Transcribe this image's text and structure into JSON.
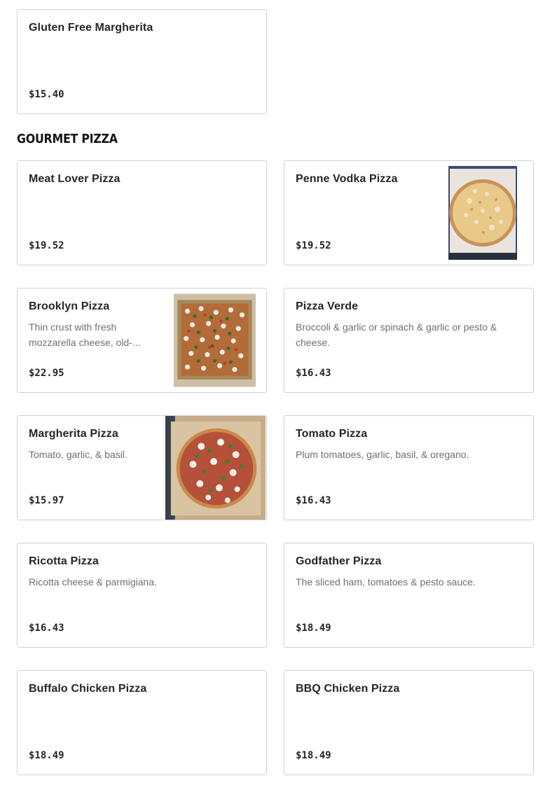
{
  "top_item": {
    "title": "Gluten Free Margherita",
    "price": "$15.40"
  },
  "section": {
    "title": "GOURMET PIZZA"
  },
  "items": [
    {
      "title": "Meat Lover Pizza",
      "desc": "",
      "price": "$19.52"
    },
    {
      "title": "Penne Vodka Pizza",
      "desc": "",
      "price": "$19.52",
      "image": "penne-vodka-pizza-photo"
    },
    {
      "title": "Brooklyn Pizza",
      "desc": "Thin crust with fresh mozzarella cheese, old-...",
      "price": "$22.95",
      "image": "brooklyn-pizza-photo"
    },
    {
      "title": "Pizza Verde",
      "desc": "Broccoli & garlic or spinach & garlic or pesto & cheese.",
      "price": "$16.43"
    },
    {
      "title": "Margherita Pizza",
      "desc": "Tomato, garlic, & basil.",
      "price": "$15.97",
      "image": "margherita-pizza-photo"
    },
    {
      "title": "Tomato Pizza",
      "desc": "Plum tomatoes, garlic, basil, & oregano.",
      "price": "$16.43"
    },
    {
      "title": "Ricotta Pizza",
      "desc": "Ricotta cheese & parmigiana.",
      "price": "$16.43"
    },
    {
      "title": "Godfather Pizza",
      "desc": "The sliced ham, tomatoes & pesto sauce.",
      "price": "$18.49"
    },
    {
      "title": "Buffalo Chicken Pizza",
      "desc": "",
      "price": "$18.49"
    },
    {
      "title": "BBQ Chicken Pizza",
      "desc": "",
      "price": "$18.49"
    }
  ]
}
